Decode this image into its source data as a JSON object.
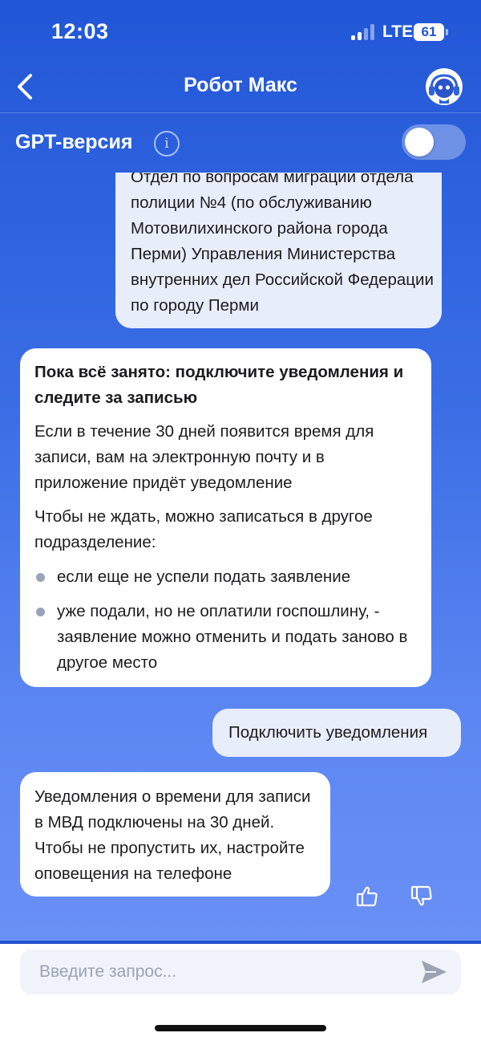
{
  "status": {
    "time": "12:03",
    "network": "LTE",
    "battery": "61"
  },
  "header": {
    "title": "Робот Макс",
    "back_icon": "chevron-left-icon",
    "avatar_icon": "robot-avatar-icon"
  },
  "gpt": {
    "label": "GPT-версия",
    "info_icon": "i",
    "toggle_on": false
  },
  "messages": {
    "m1": {
      "text": "Отдел по вопросам миграции отдела полиции №4 (по обслуживанию Мотовилихинского района города Перми) Управления Министерства внутренних дел Российской Федерации по городу Перми"
    },
    "m2": {
      "heading": "Пока всё занято: подключите уведомления и следите за записью",
      "p1": "Если в течение 30 дней появится время для записи, вам на электронную почту и в приложение придёт уведомление",
      "p2": "Чтобы не ждать, можно записаться в другое подразделение:",
      "items": [
        "если еще не успели подать заявление",
        "уже подали, но не оплатили госпошлину, - заявление можно отменить и подать заново в другое место"
      ]
    },
    "m3": {
      "text": "Подключить уведомления"
    },
    "m4": {
      "text": "Уведомления о времени для записи в МВД подключены на 30 дней. Чтобы не пропустить их, настройте оповещения на телефоне"
    }
  },
  "feedback": {
    "like_icon": "thumbs-up-icon",
    "dislike_icon": "thumbs-down-icon"
  },
  "input": {
    "placeholder": "Введите запрос...",
    "value": "",
    "send_icon": "send-icon"
  },
  "colors": {
    "accent": "#2156d6",
    "bubble_user": "#e8edfa",
    "bubble_bot": "#ffffff"
  }
}
